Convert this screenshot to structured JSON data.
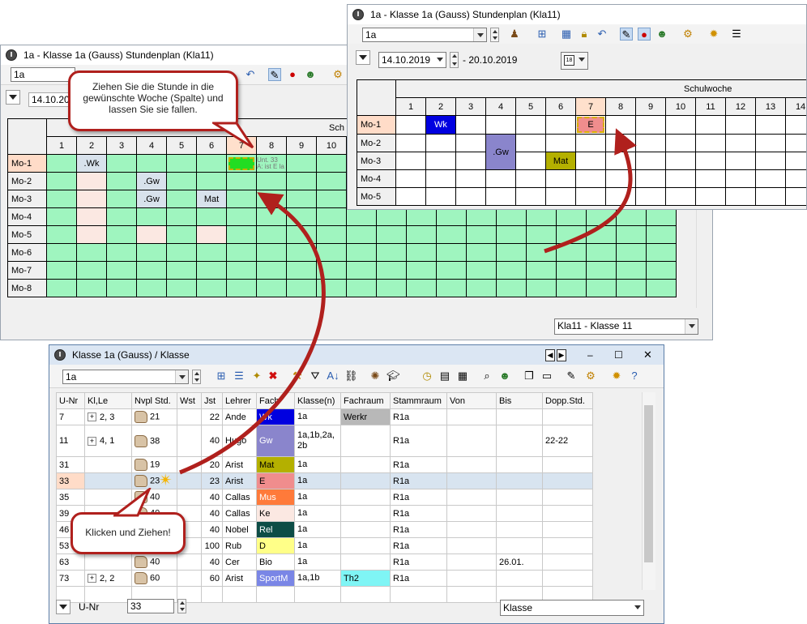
{
  "win_top": {
    "title": "1a - Klasse 1a (Gauss)  Stundenplan  (Kla11)",
    "combo_value": "1a",
    "date_from": "14.10.2019",
    "date_to": "- 20.10.2019",
    "schulwoche": "Schulwoche",
    "cols": [
      "1",
      "2",
      "3",
      "4",
      "5",
      "6",
      "7",
      "8",
      "9",
      "10",
      "11",
      "12",
      "13",
      "14"
    ],
    "rows": [
      "Mo-1",
      "Mo-2",
      "Mo-3",
      "Mo-4",
      "Mo-5"
    ],
    "lesson_wk": "Wk",
    "lesson_gw": ".Gw",
    "lesson_mat": "Mat",
    "lesson_e": "E",
    "colors": {
      "wk": "#0000e0",
      "gw": "#8a85cc",
      "mat": "#b4b000",
      "e": "#f08d8d"
    }
  },
  "win_left": {
    "title": "1a - Klasse 1a (Gauss)  Stundenplan  (Kla11)",
    "combo_value": "1a",
    "date_from": "14.10.201",
    "schul": "Sch",
    "cols": [
      "1",
      "2",
      "3",
      "4",
      "5",
      "6",
      "7",
      "8",
      "9",
      "10"
    ],
    "rows": [
      "Mo-1",
      "Mo-2",
      "Mo-3",
      "Mo-4",
      "Mo-5",
      "Mo-6",
      "Mo-7",
      "Mo-8"
    ],
    "lesson_wk": ".Wk",
    "lesson_gw1": ".Gw",
    "lesson_gw2": ".Gw",
    "lesson_mat": "Mat",
    "ghost_line1": "Unt. 33",
    "ghost_line2": "A: ist E  la",
    "bottom_combo": "Kla11 - Klasse 11"
  },
  "win_bottom": {
    "title": "Klasse 1a (Gauss) / Klasse",
    "combo_value": "1a",
    "headers": [
      "U-Nr",
      "Kl,Le",
      "Nvpl Std.",
      "Wst",
      "Jst",
      "Lehrer",
      "Fach",
      "Klasse(n)",
      "Fachraum",
      "Stammraum",
      "Von",
      "Bis",
      "Dopp.Std."
    ],
    "rows": [
      {
        "unr": "7",
        "klle": "2, 3",
        "nvpl": "21",
        "wst": "",
        "jst": "22",
        "lehrer": "Ande",
        "fach": "Wk",
        "fachcolor": "#0000e0",
        "fachtext": "#ffffff",
        "klassen": "1a",
        "fachraum": "Werkr",
        "stammraum": "R1a",
        "von": "",
        "bis": "",
        "dopp": ""
      },
      {
        "unr": "11",
        "klle": "4, 1",
        "nvpl": "38",
        "wst": "",
        "jst": "40",
        "lehrer": "Hugo",
        "fach": "Gw",
        "fachcolor": "#8a85cc",
        "fachtext": "#ffffff",
        "klassen": "1a,1b,2a, 2b",
        "fachraum": "",
        "stammraum": "R1a",
        "von": "",
        "bis": "",
        "dopp": "22-22"
      },
      {
        "unr": "31",
        "klle": "",
        "nvpl": "19",
        "wst": "",
        "jst": "20",
        "lehrer": "Arist",
        "fach": "Mat",
        "fachcolor": "#b4b000",
        "fachtext": "#000000",
        "klassen": "1a",
        "fachraum": "",
        "stammraum": "R1a",
        "von": "",
        "bis": "",
        "dopp": ""
      },
      {
        "unr": "33",
        "klle": "",
        "nvpl": "23",
        "wst": "",
        "jst": "23",
        "lehrer": "Arist",
        "fach": "E",
        "fachcolor": "#f08d8d",
        "fachtext": "#000000",
        "klassen": "1a",
        "fachraum": "",
        "stammraum": "R1a",
        "von": "",
        "bis": "",
        "dopp": ""
      },
      {
        "unr": "35",
        "klle": "",
        "nvpl": "40",
        "wst": "",
        "jst": "40",
        "lehrer": "Callas",
        "fach": "Mus",
        "fachcolor": "#ff7a3a",
        "fachtext": "#ffffff",
        "klassen": "1a",
        "fachraum": "",
        "stammraum": "R1a",
        "von": "",
        "bis": "",
        "dopp": ""
      },
      {
        "unr": "39",
        "klle": "",
        "nvpl": "40",
        "wst": "",
        "jst": "40",
        "lehrer": "Callas",
        "fach": "Ke",
        "fachcolor": "#fbe8e2",
        "fachtext": "#000000",
        "klassen": "1a",
        "fachraum": "",
        "stammraum": "R1a",
        "von": "",
        "bis": "",
        "dopp": ""
      },
      {
        "unr": "46",
        "klle": "",
        "nvpl": "40",
        "wst": "",
        "jst": "40",
        "lehrer": "Nobel",
        "fach": "Rel",
        "fachcolor": "#0d4d46",
        "fachtext": "#ffffff",
        "klassen": "1a",
        "fachraum": "",
        "stammraum": "R1a",
        "von": "",
        "bis": "",
        "dopp": ""
      },
      {
        "unr": "53",
        "klle": "",
        "nvpl": "",
        "wst": "",
        "jst": "100",
        "lehrer": "Rub",
        "fach": "D",
        "fachcolor": "#ffff88",
        "fachtext": "#000000",
        "klassen": "1a",
        "fachraum": "",
        "stammraum": "R1a",
        "von": "",
        "bis": "",
        "dopp": ""
      },
      {
        "unr": "63",
        "klle": "",
        "nvpl": "40",
        "wst": "",
        "jst": "40",
        "lehrer": "Cer",
        "fach": "Bio",
        "fachcolor": "#ffffff",
        "fachtext": "#000000",
        "klassen": "1a",
        "fachraum": "",
        "stammraum": "R1a",
        "von": "",
        "bis": "26.01.",
        "dopp": ""
      },
      {
        "unr": "73",
        "klle": "2, 2",
        "nvpl": "60",
        "wst": "",
        "jst": "60",
        "lehrer": "Arist",
        "fach": "SportM",
        "fachcolor": "#7a86e6",
        "fachtext": "#ffffff",
        "klassen": "1a,1b",
        "fachraum": "Th2",
        "stammraum": "R1a",
        "von": "",
        "bis": "",
        "dopp": ""
      }
    ],
    "footer_label": "U-Nr",
    "footer_value": "33",
    "footer_combo": "Klasse"
  },
  "callouts": {
    "drag_hint": "Ziehen Sie die Stunde in die gewünschte Woche (Spalte) und lassen Sie sie fallen.",
    "click_hint": "Klicken und Ziehen!"
  }
}
